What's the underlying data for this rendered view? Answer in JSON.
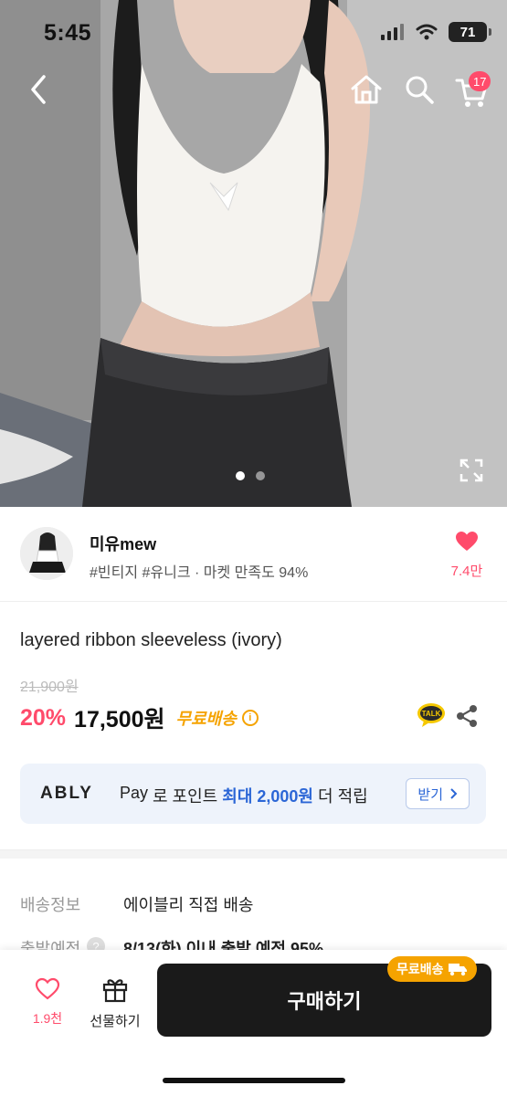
{
  "status_bar": {
    "time": "5:45",
    "battery": "71"
  },
  "nav": {
    "cart_count": "17"
  },
  "gallery": {
    "total_slides": 2,
    "active_slide": 1
  },
  "seller": {
    "name": "미유mew",
    "tags": "#빈티지 #유니크 · 마켓 만족도 94%",
    "likes": "7.4만"
  },
  "product": {
    "title": "layered ribbon sleeveless (ivory)",
    "original_price": "21,900원",
    "discount": "20%",
    "price": "17,500원",
    "free_shipping": "무료배송"
  },
  "ably_banner": {
    "logo": "ABLY",
    "pay": "Pay",
    "text_prefix": "로 포인트",
    "highlight": "최대 2,000원",
    "text_suffix": "더 적립",
    "button": "받기"
  },
  "shipping": {
    "label": "배송정보",
    "value": "에이블리 직접 배송",
    "dispatch_label": "출발예정",
    "dispatch_value": "8/13(화) 이내 출발 예정 95%"
  },
  "bottom_bar": {
    "wish_count": "1.9천",
    "gift_label": "선물하기",
    "buy_label": "구매하기",
    "buy_tag": "무료배송"
  },
  "colors": {
    "accent_pink": "#ff4b6b",
    "free_ship_orange": "#f5a300",
    "ably_blue": "#2b66d6"
  }
}
